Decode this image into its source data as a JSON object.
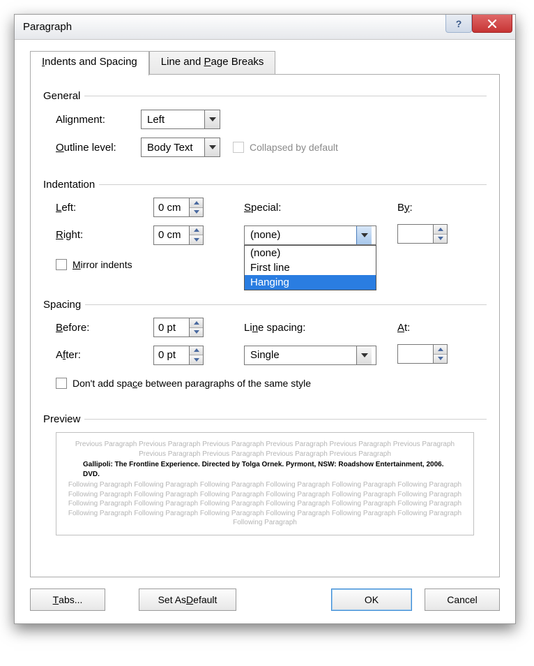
{
  "title": "Paragraph",
  "tabs": {
    "indents": "Indents and Spacing",
    "breaks": "Line and Page Breaks"
  },
  "general": {
    "header": "General",
    "alignment_label": "Alignment:",
    "alignment_value": "Left",
    "outline_label": "Outline level:",
    "outline_value": "Body Text",
    "collapsed_label": "Collapsed by default"
  },
  "indentation": {
    "header": "Indentation",
    "left_label": "Left:",
    "left_value": "0 cm",
    "right_label": "Right:",
    "right_value": "0 cm",
    "special_label": "Special:",
    "special_value": "(none)",
    "special_options": {
      "none": "(none)",
      "first": "First line",
      "hanging": "Hanging"
    },
    "by_label": "By:",
    "by_value": "",
    "mirror_label": "Mirror indents"
  },
  "spacing": {
    "header": "Spacing",
    "before_label": "Before:",
    "before_value": "0 pt",
    "after_label": "After:",
    "after_value": "0 pt",
    "line_spacing_label": "Line spacing:",
    "line_spacing_value": "Single",
    "at_label": "At:",
    "at_value": "",
    "dont_add_label": "Don't add space between paragraphs of the same style"
  },
  "preview": {
    "header": "Preview",
    "before_text": "Previous Paragraph Previous Paragraph Previous Paragraph Previous Paragraph Previous Paragraph Previous Paragraph Previous Paragraph Previous Paragraph Previous Paragraph Previous Paragraph",
    "sample": "Gallipoli: The Frontline Experience. Directed by Tolga Ornek. Pyrmont, NSW: Roadshow Entertainment, 2006. DVD.",
    "after_text": "Following Paragraph Following Paragraph Following Paragraph Following Paragraph Following Paragraph Following Paragraph Following Paragraph Following Paragraph Following Paragraph Following Paragraph Following Paragraph Following Paragraph Following Paragraph Following Paragraph Following Paragraph Following Paragraph Following Paragraph Following Paragraph Following Paragraph Following Paragraph Following Paragraph Following Paragraph Following Paragraph Following Paragraph Following Paragraph"
  },
  "buttons": {
    "tabs": "Tabs...",
    "default": "Set As Default",
    "ok": "OK",
    "cancel": "Cancel"
  }
}
